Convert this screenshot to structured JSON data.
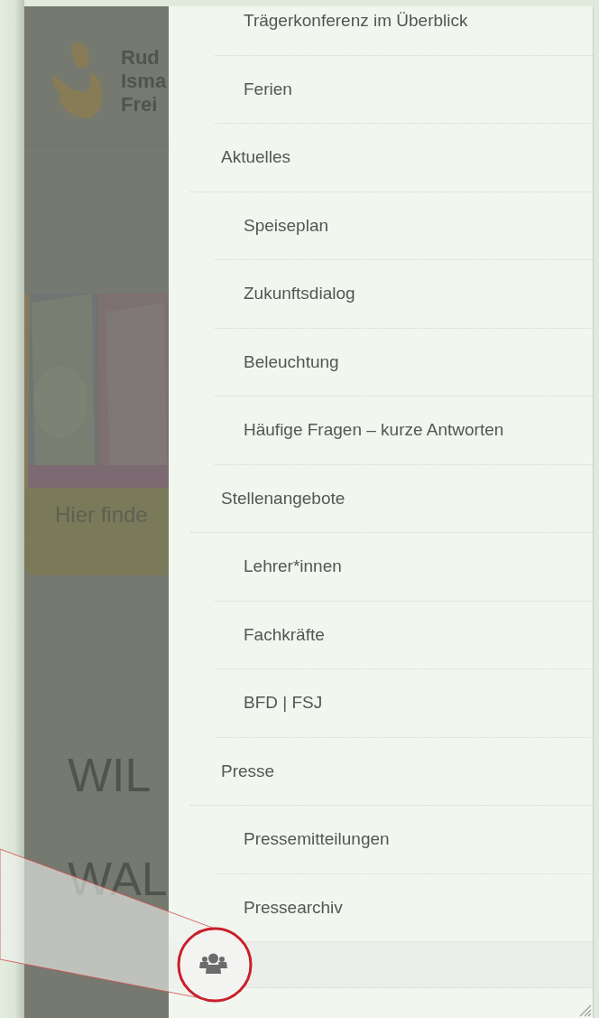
{
  "background_page": {
    "logo_lines": [
      "Rud",
      "Isma",
      "Frei"
    ],
    "banner": {
      "kind": "picture",
      "caption": "Hier finde"
    },
    "heading_lines": [
      "WIL",
      "WAL"
    ]
  },
  "menu": {
    "items": [
      {
        "children": [
          {
            "label": "Trägerkonferenz im Überblick"
          },
          {
            "label": "Ferien"
          }
        ]
      },
      {
        "label": "Aktuelles",
        "children": [
          {
            "label": "Speiseplan"
          },
          {
            "label": "Zukunftsdialog"
          },
          {
            "label": "Beleuchtung"
          },
          {
            "label": "Häufige Fragen – kurze Antworten"
          }
        ]
      },
      {
        "label": "Stellenangebote",
        "children": [
          {
            "label": "Lehrer*innen"
          },
          {
            "label": "Fachkräfte"
          },
          {
            "label": "BFD | FSJ"
          }
        ]
      },
      {
        "label": "Presse",
        "children": [
          {
            "label": "Pressemitteilungen"
          },
          {
            "label": "Pressearchiv"
          }
        ]
      }
    ]
  }
}
